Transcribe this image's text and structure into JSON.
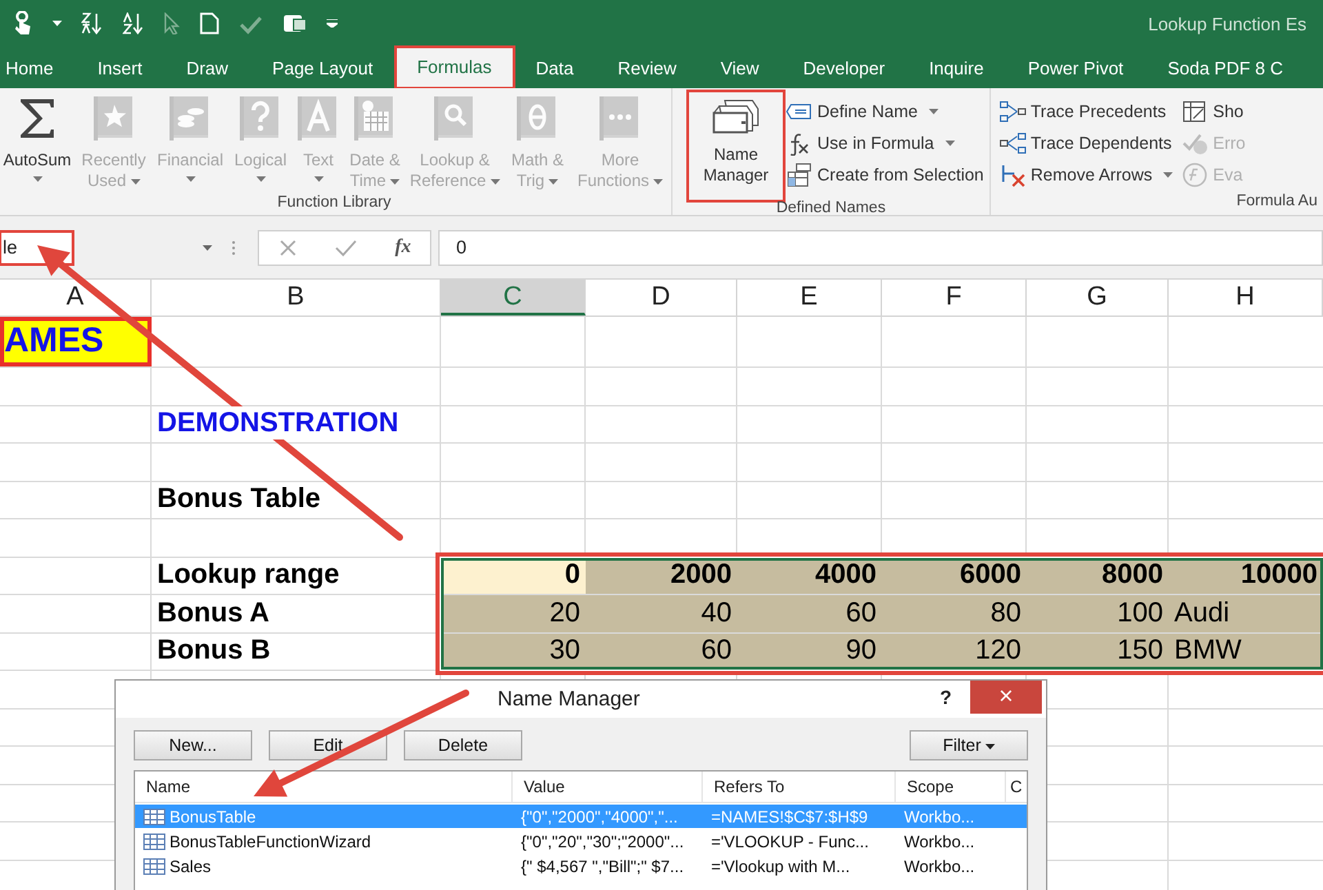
{
  "title_bar": {
    "title": "Lookup Function Es"
  },
  "ribbon_tabs": [
    {
      "label": "Home",
      "selected": false,
      "highlighted": false
    },
    {
      "label": "Insert",
      "selected": false,
      "highlighted": false
    },
    {
      "label": "Draw",
      "selected": false,
      "highlighted": false
    },
    {
      "label": "Page Layout",
      "selected": false,
      "highlighted": false
    },
    {
      "label": "Formulas",
      "selected": true,
      "highlighted": true
    },
    {
      "label": "Data",
      "selected": false,
      "highlighted": false
    },
    {
      "label": "Review",
      "selected": false,
      "highlighted": false
    },
    {
      "label": "View",
      "selected": false,
      "highlighted": false
    },
    {
      "label": "Developer",
      "selected": false,
      "highlighted": false
    },
    {
      "label": "Inquire",
      "selected": false,
      "highlighted": false
    },
    {
      "label": "Power Pivot",
      "selected": false,
      "highlighted": false
    },
    {
      "label": "Soda PDF 8 C",
      "selected": false,
      "highlighted": false
    }
  ],
  "ribbon_groups": [
    {
      "label": "Function Library",
      "commands": [
        {
          "kind": "large",
          "label": "AutoSum",
          "disabled": false,
          "dropdown": true,
          "highlighted": false
        },
        {
          "kind": "large",
          "label": "Recently Used",
          "disabled": true,
          "dropdown": true,
          "highlighted": false
        },
        {
          "kind": "large",
          "label": "Financial",
          "disabled": true,
          "dropdown": true,
          "highlighted": false
        },
        {
          "kind": "large",
          "label": "Logical",
          "disabled": true,
          "dropdown": true,
          "highlighted": false
        },
        {
          "kind": "large",
          "label": "Text",
          "disabled": true,
          "dropdown": true,
          "highlighted": false
        },
        {
          "kind": "large",
          "label": "Date & Time",
          "disabled": true,
          "dropdown": true,
          "highlighted": false
        },
        {
          "kind": "large",
          "label": "Lookup & Reference",
          "disabled": true,
          "dropdown": true,
          "highlighted": false
        },
        {
          "kind": "large",
          "label": "Math & Trig",
          "disabled": true,
          "dropdown": true,
          "highlighted": false
        },
        {
          "kind": "large",
          "label": "More Functions",
          "disabled": true,
          "dropdown": true,
          "highlighted": false
        }
      ]
    },
    {
      "label": "Defined Names",
      "commands": [
        {
          "kind": "large",
          "label": "Name Manager",
          "disabled": false,
          "dropdown": false,
          "highlighted": true
        },
        {
          "kind": "small",
          "label": "Define Name",
          "disabled": false,
          "dropdown": true,
          "highlighted": false
        },
        {
          "kind": "small",
          "label": "Use in Formula",
          "disabled": false,
          "dropdown": true,
          "highlighted": false
        },
        {
          "kind": "small",
          "label": "Create from Selection",
          "disabled": false,
          "dropdown": false,
          "highlighted": false
        }
      ]
    },
    {
      "label": "Formula Au",
      "commands": [
        {
          "kind": "small",
          "label": "Trace Precedents",
          "disabled": false,
          "dropdown": false,
          "highlighted": false
        },
        {
          "kind": "small",
          "label": "Trace Dependents",
          "disabled": false,
          "dropdown": false,
          "highlighted": false
        },
        {
          "kind": "small",
          "label": "Remove Arrows",
          "disabled": false,
          "dropdown": true,
          "highlighted": false
        },
        {
          "kind": "small",
          "label": "Sho",
          "disabled": false,
          "dropdown": false,
          "highlighted": false
        },
        {
          "kind": "small",
          "label": "Erro",
          "disabled": true,
          "dropdown": false,
          "highlighted": false
        },
        {
          "kind": "small",
          "label": "Eva",
          "disabled": true,
          "dropdown": false,
          "highlighted": false
        }
      ]
    }
  ],
  "formula_bar": {
    "name_box": "le",
    "name_box_highlighted": true,
    "insert_function": "fx",
    "formula": "0"
  },
  "sheet": {
    "range_highlighted": true,
    "columns": [
      {
        "label": "A",
        "selected": false,
        "in_range": false
      },
      {
        "label": "B",
        "selected": false,
        "in_range": false
      },
      {
        "label": "C",
        "selected": true,
        "in_range": true
      },
      {
        "label": "D",
        "selected": false,
        "in_range": true
      },
      {
        "label": "E",
        "selected": false,
        "in_range": true
      },
      {
        "label": "F",
        "selected": false,
        "in_range": true
      },
      {
        "label": "G",
        "selected": false,
        "in_range": true
      },
      {
        "label": "H",
        "selected": false,
        "in_range": true
      }
    ],
    "rows": [
      {
        "in_range": false,
        "cells": [
          {
            "text": "AMES",
            "kind": "banner"
          }
        ]
      },
      {
        "in_range": false,
        "cells": []
      },
      {
        "in_range": false,
        "cells": [
          null,
          {
            "text": "DEMONSTRATION",
            "kind": "heading",
            "active": false
          }
        ]
      },
      {
        "in_range": false,
        "cells": []
      },
      {
        "in_range": false,
        "cells": [
          null,
          {
            "text": "Bonus Table",
            "kind": "label",
            "active": false
          }
        ]
      },
      {
        "in_range": false,
        "cells": []
      },
      {
        "in_range": true,
        "cells": [
          null,
          {
            "text": "Lookup range",
            "kind": "label",
            "active": false
          },
          {
            "text": "0",
            "kind": "number-bold",
            "active": true
          },
          {
            "text": "2000",
            "kind": "number-bold",
            "active": false
          },
          {
            "text": "4000",
            "kind": "number-bold",
            "active": false
          },
          {
            "text": "6000",
            "kind": "number-bold",
            "active": false
          },
          {
            "text": "8000",
            "kind": "number-bold",
            "active": false
          },
          {
            "text": "10000",
            "kind": "number-bold",
            "active": false
          }
        ]
      },
      {
        "in_range": true,
        "cells": [
          null,
          {
            "text": "Bonus A",
            "kind": "label",
            "active": false
          },
          {
            "text": "20",
            "kind": "number",
            "active": false
          },
          {
            "text": "40",
            "kind": "number",
            "active": false
          },
          {
            "text": "60",
            "kind": "number",
            "active": false
          },
          {
            "text": "80",
            "kind": "number",
            "active": false
          },
          {
            "text": "100",
            "kind": "number",
            "active": false
          },
          {
            "text": "Audi",
            "kind": "text",
            "active": false
          }
        ]
      },
      {
        "in_range": true,
        "cells": [
          null,
          {
            "text": "Bonus B",
            "kind": "label",
            "active": false
          },
          {
            "text": "30",
            "kind": "number",
            "active": false
          },
          {
            "text": "60",
            "kind": "number",
            "active": false
          },
          {
            "text": "90",
            "kind": "number",
            "active": false
          },
          {
            "text": "120",
            "kind": "number",
            "active": false
          },
          {
            "text": "150",
            "kind": "number",
            "active": false
          },
          {
            "text": "BMW",
            "kind": "text",
            "active": false
          }
        ]
      }
    ]
  },
  "dialog": {
    "title": "Name Manager",
    "help": "?",
    "close": "×",
    "buttons": [
      {
        "label": "New...",
        "dropdown": false
      },
      {
        "label": "Edit",
        "dropdown": false
      },
      {
        "label": "Delete",
        "dropdown": false
      },
      {
        "label": "Filter",
        "dropdown": true
      }
    ],
    "columns": [
      "Name",
      "Value",
      "Refers To",
      "Scope",
      "C"
    ],
    "rows": [
      {
        "name": "BonusTable",
        "value": "{\"0\",\"2000\",\"4000\",\"...",
        "refers_to": "=NAMES!$C$7:$H$9",
        "scope": "Workbo...",
        "selected": true
      },
      {
        "name": "BonusTableFunctionWizard",
        "value": "{\"0\",\"20\",\"30\";\"2000\"...",
        "refers_to": "='VLOOKUP - Func...",
        "scope": "Workbo...",
        "selected": false
      },
      {
        "name": "Sales",
        "value": "{\" $4,567 \",\"Bill\";\" $7...",
        "refers_to": "='Vlookup with M...",
        "scope": "Workbo...",
        "selected": false
      }
    ]
  }
}
